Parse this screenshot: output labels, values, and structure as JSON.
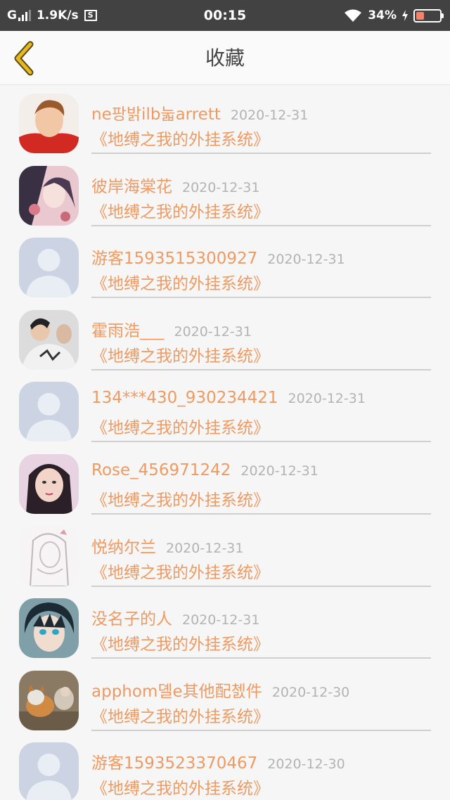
{
  "status_bar": {
    "carrier": "G",
    "speed": "1.9K/s",
    "sim_icon": "S",
    "time": "00:15",
    "battery_text": "34%",
    "battery_level": 0.34,
    "icons": [
      "signal-icon",
      "wifi-icon",
      "charging-icon",
      "battery-icon"
    ]
  },
  "header": {
    "title": "收藏",
    "back_icon": "chevron-left-icon",
    "accent_color": "#e8b820"
  },
  "items": [
    {
      "name": "ne팡밝ilb눏arrett",
      "date": "2020-12-31",
      "book": "《地缚之我的外挂系统》",
      "avatar": "avatar-photo-child"
    },
    {
      "name": "彼岸海棠花",
      "date": "2020-12-31",
      "book": "《地缚之我的外挂系统》",
      "avatar": "avatar-anime-girl"
    },
    {
      "name": "游客1593515300927",
      "date": "2020-12-31",
      "book": "《地缚之我的外挂系统》",
      "avatar": "avatar-default"
    },
    {
      "name": "霍雨浩___",
      "date": "2020-12-31",
      "book": "《地缚之我的外挂系统》",
      "avatar": "avatar-photo-boy"
    },
    {
      "name": "134***430_930234421",
      "date": "2020-12-31",
      "book": "《地缚之我的外挂系统》",
      "avatar": "avatar-default"
    },
    {
      "name": "Rose_456971242",
      "date": "2020-12-31",
      "book": "《地缚之我的外挂系统》",
      "avatar": "avatar-photo-woman"
    },
    {
      "name": "悦纳尔兰",
      "date": "2020-12-31",
      "book": "《地缚之我的外挂系统》",
      "avatar": "avatar-sketch"
    },
    {
      "name": "没名子的人",
      "date": "2020-12-31",
      "book": "《地缚之我的外挂系统》",
      "avatar": "avatar-anime-boy"
    },
    {
      "name": "apphom뎰e其他配쳀件",
      "date": "2020-12-30",
      "book": "《地缚之我的外挂系统》",
      "avatar": "avatar-photo-dog"
    },
    {
      "name": "游客1593523370467",
      "date": "2020-12-30",
      "book": "《地缚之我的外挂系统》",
      "avatar": "avatar-default"
    }
  ],
  "colors": {
    "name": "#ee9a62",
    "date": "#b3b3b3",
    "status_bar": "#424242"
  }
}
